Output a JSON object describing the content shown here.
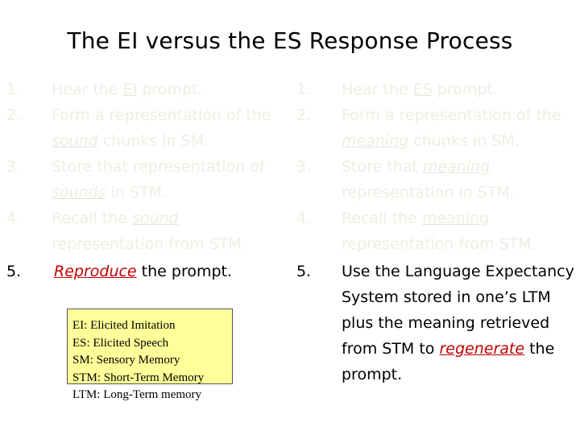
{
  "title": "The EI versus the ES Response Process",
  "left_column": {
    "items": [
      {
        "num": "1.",
        "pre": "Hear the ",
        "em": "EI",
        "post": " prompt."
      },
      {
        "num": "2.",
        "line1": "Form a representation of the",
        "em": "sound",
        "post": " chunks in SM."
      },
      {
        "num": "3.",
        "line1": "Store that representation of",
        "em": "sounds",
        "post": " in STM."
      },
      {
        "num": "4.",
        "pre": "Recall the ",
        "em": "sound",
        "line2": "representation from STM."
      },
      {
        "num": "5.",
        "em": "Reproduce",
        "post": " the prompt."
      }
    ]
  },
  "right_column": {
    "items": [
      {
        "num": "1.",
        "pre": "Hear the ",
        "em": "ES",
        "post": " prompt."
      },
      {
        "num": "2.",
        "line1": "Form a representation of the",
        "em": "meaning",
        "post": " chunks in SM."
      },
      {
        "num": "3.",
        "pre": "Store that ",
        "em": "meaning",
        "line2": "representation in STM."
      },
      {
        "num": "4.",
        "pre": "Recall the ",
        "em": "meaning",
        "line2": "representation from STM."
      },
      {
        "num": "5.",
        "line1": "Use the Language Expectancy",
        "line2": "System stored in one’s LTM",
        "line3": "plus the meaning retrieved",
        "pre4": "from STM to ",
        "em": "regenerate",
        "post4": " the",
        "line5": "prompt."
      }
    ]
  },
  "legend": {
    "entries": [
      "EI: Elicited Imitation",
      "ES: Elicited Speech",
      "SM: Sensory Memory",
      "STM: Short-Term Memory",
      "LTM: Long-Term memory"
    ]
  }
}
